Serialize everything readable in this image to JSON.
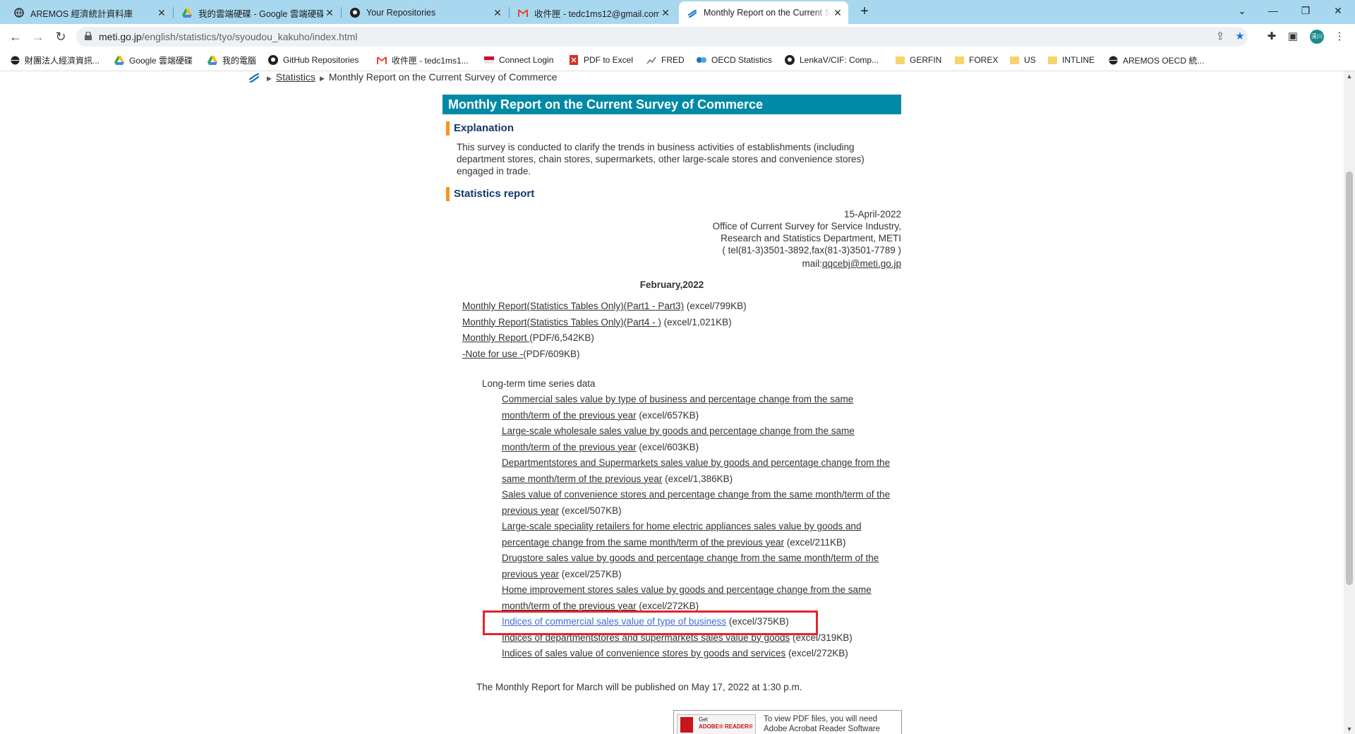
{
  "browser": {
    "tabs": [
      {
        "title": "AREMOS 經濟統計資料庫",
        "icon": "globe-icon"
      },
      {
        "title": "我的雲端硬碟 - Google 雲端硬碟",
        "icon": "google-drive-icon"
      },
      {
        "title": "Your Repositories",
        "icon": "github-icon"
      },
      {
        "title": "收件匣 - tedc1ms12@gmail.com",
        "icon": "gmail-icon"
      },
      {
        "title": "Monthly Report on the Current Survey",
        "icon": "meti-icon",
        "active": true
      }
    ],
    "url_host": "meti.go.jp",
    "url_path": "/english/statistics/tyo/syoudou_kakuho/index.html",
    "profile_initials": "溪川",
    "bookmarks": [
      {
        "label": "財團法人經濟資訊...",
        "icon": "globe-icon"
      },
      {
        "label": "Google 雲端硬碟",
        "icon": "google-drive-icon"
      },
      {
        "label": "我的電腦",
        "icon": "google-drive-icon"
      },
      {
        "label": "GitHub Repositories",
        "icon": "github-icon"
      },
      {
        "label": "收件匣 - tedc1ms1...",
        "icon": "gmail-icon"
      },
      {
        "label": "Connect Login",
        "icon": "flag-icon"
      },
      {
        "label": "PDF to Excel",
        "icon": "pdf-icon"
      },
      {
        "label": "FRED",
        "icon": "chart-icon"
      },
      {
        "label": "OECD Statistics",
        "icon": "oecd-icon"
      },
      {
        "label": "LenkaV/CIF: Comp...",
        "icon": "github-icon"
      },
      {
        "label": "GERFIN",
        "icon": "folder-icon"
      },
      {
        "label": "FOREX",
        "icon": "folder-icon"
      },
      {
        "label": "US",
        "icon": "folder-icon"
      },
      {
        "label": "INTLINE",
        "icon": "folder-icon"
      },
      {
        "label": "AREMOS OECD 統...",
        "icon": "globe-icon"
      }
    ]
  },
  "page": {
    "breadcrumb": {
      "link": "Statistics",
      "current": "Monthly Report on the Current Survey of Commerce"
    },
    "title": "Monthly Report on the Current Survey of Commerce",
    "explanation_heading": "Explanation",
    "explanation_text": "This survey is conducted to clarify the trends in business activities of establishments (including department stores, chain stores, supermarkets, other large-scale stores and convenience stores) engaged in trade.",
    "stats_heading": "Statistics report",
    "contact": {
      "date": "15-April-2022",
      "office": "Office of Current Survey for Service Industry,",
      "dept": "Research and Statistics Department, METI",
      "tel": "( tel(81-3)3501-3892,fax(81-3)3501-7789 )",
      "mail_prefix": "mail:",
      "mail": "qqcebj@meti.go.jp"
    },
    "month": "February,2022",
    "reports": [
      {
        "link": "Monthly Report(Statistics Tables Only)(Part1 - Part3)",
        "meta": " (excel/799KB)"
      },
      {
        "link": "Monthly Report(Statistics Tables Only)(Part4 - )",
        "meta": " (excel/1,021KB)"
      },
      {
        "link": "Monthly Report ",
        "meta": "(PDF/6,542KB)"
      },
      {
        "link": "-Note for use -",
        "meta": "(PDF/609KB)"
      }
    ],
    "longterm_heading": "Long-term time series data",
    "longterm": [
      {
        "link": "Commercial sales value by type of business and percentage change from the same month/term of the previous year",
        "meta": " (excel/657KB)"
      },
      {
        "link": "Large-scale wholesale sales value by goods and percentage change from the same month/term of the previous year",
        "meta": " (excel/603KB)"
      },
      {
        "link": "Departmentstores and Supermarkets sales value by goods and percentage change from the same month/term of the previous year",
        "meta": " (excel/1,386KB)"
      },
      {
        "link": "Sales value of convenience stores and percentage change from the same month/term of the previous year",
        "meta": " (excel/507KB)"
      },
      {
        "link": "Large-scale speciality retailers for home electric appliances sales value by goods and percentage change from the same month/term of the previous year",
        "meta": " (excel/211KB)"
      },
      {
        "link": "Drugstore sales value by goods and percentage change from the same month/term of the previous year",
        "meta": " (excel/257KB)"
      },
      {
        "link": "Home improvement stores sales value by goods and percentage change from the same month/term of the previous year",
        "meta": " (excel/272KB)"
      },
      {
        "link": "Indices of commercial sales value of type of business",
        "meta": " (excel/375KB)",
        "highlighted": true
      },
      {
        "link": "Indices of departmentstores and supermarkets sales value by goods",
        "meta": " (excel/319KB)"
      },
      {
        "link": "Indices of sales value of convenience stores by goods and services",
        "meta": " (excel/272KB)"
      }
    ],
    "next_publication": "The Monthly Report for March will be published on May 17, 2022 at 1:30 p.m.",
    "adobe": {
      "badge_line1": "Get",
      "badge_line2": "ADOBE® READER®",
      "text_line1": "To view PDF files, you will need",
      "text_line2": "Adobe Acrobat Reader Software"
    }
  },
  "colors": {
    "title_bar": "#008aa5",
    "heading_accent": "#f7941d",
    "heading_text": "#13386b",
    "highlight_box": "#e8222a",
    "tab_strip": "#a8d8ef"
  }
}
